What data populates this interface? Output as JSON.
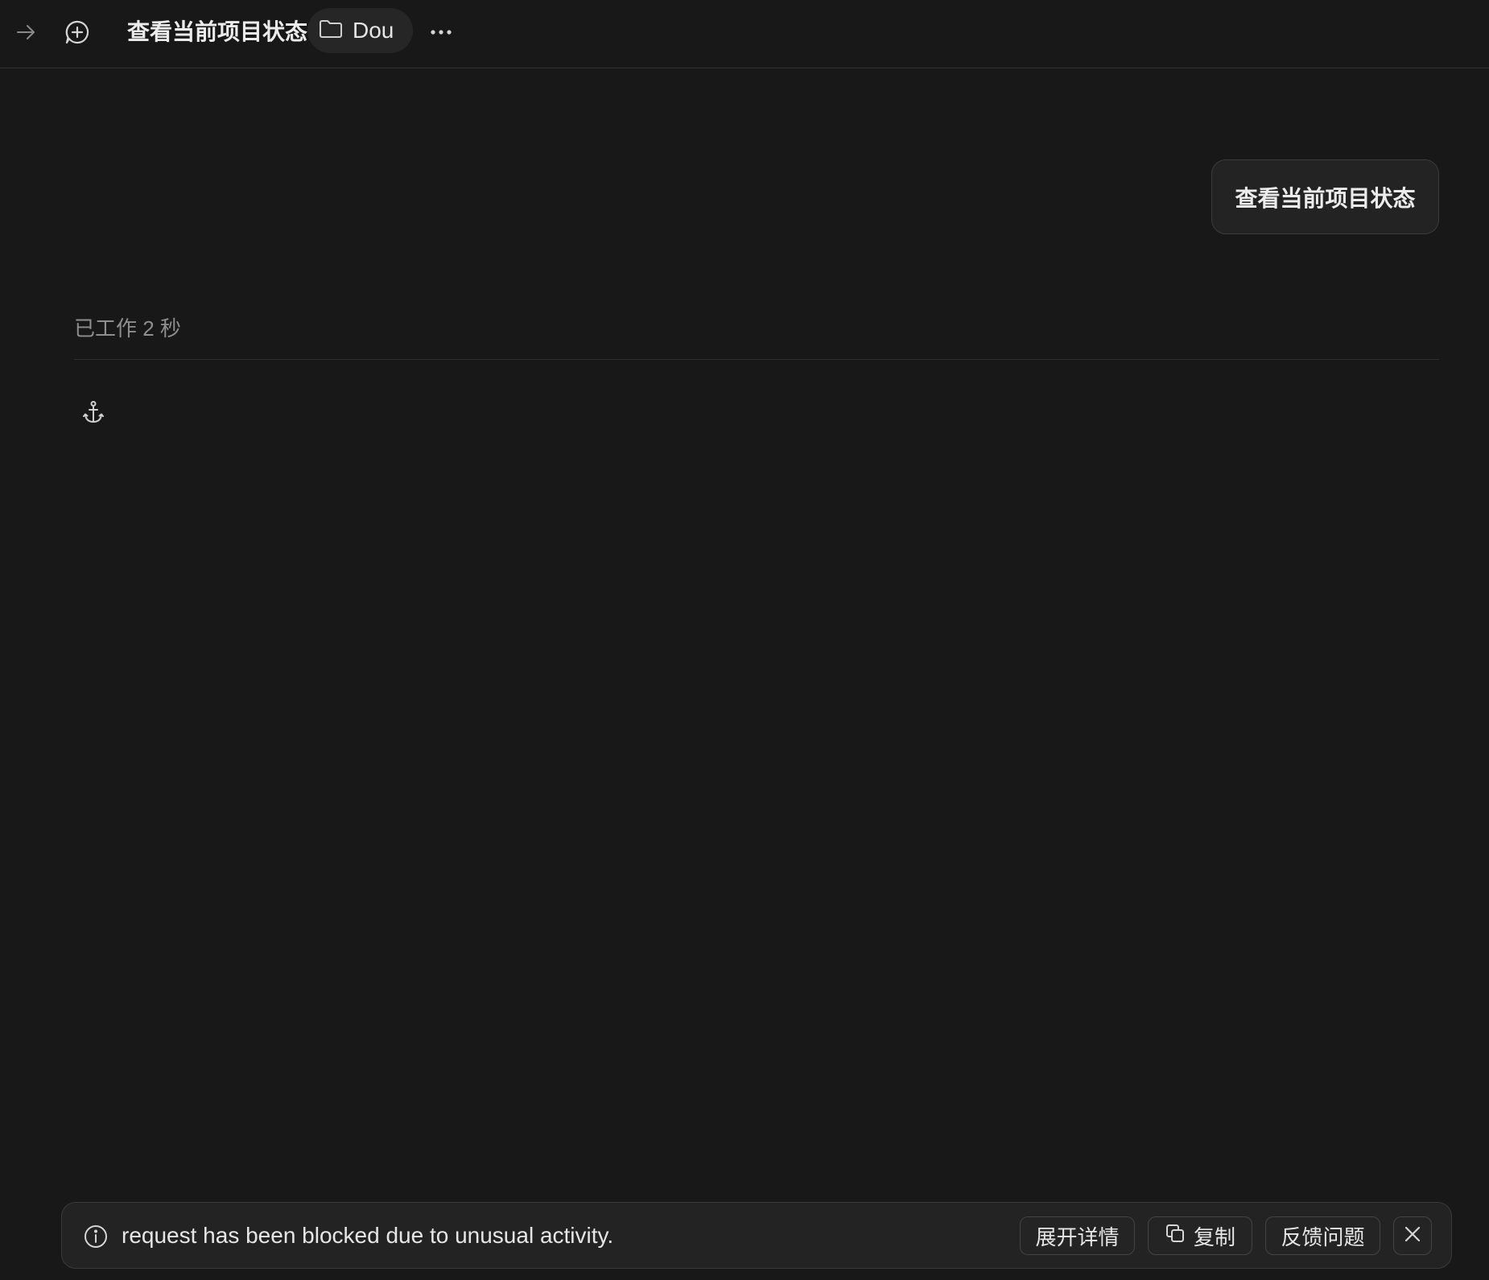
{
  "header": {
    "title": "查看当前项目状态",
    "folder": "Dou",
    "icons": {
      "forward": "arrow-right-icon",
      "new_chat": "chat-plus-icon",
      "folder": "folder-icon",
      "more": "ellipsis-icon"
    }
  },
  "conversation": {
    "user_message": "查看当前项目状态",
    "worked_status": "已工作 2 秒",
    "agent_icon": "anchor-icon"
  },
  "error_toast": {
    "message": "request has been blocked due to unusual activity.",
    "expand_label": "展开详情",
    "copy_label": "复制",
    "feedback_label": "反馈问题",
    "icons": {
      "info": "info-icon",
      "copy": "copy-icon",
      "close": "close-icon"
    }
  },
  "colors": {
    "background": "#181818",
    "surface": "#232323",
    "border": "#3a3a3a",
    "text": "#e6e6e6",
    "muted": "#8e8e8e"
  }
}
